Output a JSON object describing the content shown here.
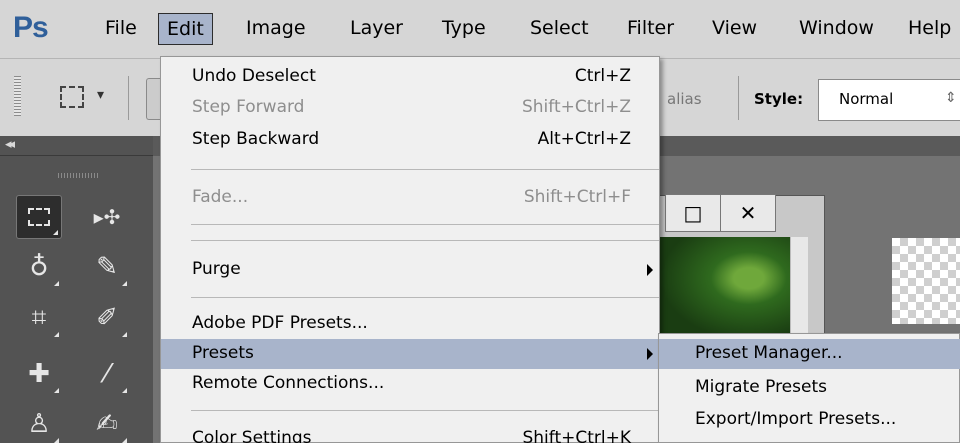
{
  "app": {
    "logo_text": "Ps",
    "brand_color": "#2f5f9a"
  },
  "menubar": {
    "items": [
      "File",
      "Edit",
      "Image",
      "Layer",
      "Type",
      "Select",
      "Filter",
      "View",
      "Window",
      "Help"
    ]
  },
  "options_bar": {
    "antialias_label": "alias",
    "style_label": "Style:",
    "style_value": "Normal"
  },
  "edit_menu": {
    "items": [
      {
        "label": "Undo Deselect",
        "shortcut": "Ctrl+Z",
        "enabled": true
      },
      {
        "label": "Step Forward",
        "shortcut": "Shift+Ctrl+Z",
        "enabled": false
      },
      {
        "label": "Step Backward",
        "shortcut": "Alt+Ctrl+Z",
        "enabled": true
      },
      {
        "label": "Fade...",
        "shortcut": "Shift+Ctrl+F",
        "enabled": false
      },
      {
        "label": "Purge",
        "shortcut": "",
        "enabled": true,
        "submenu": true
      },
      {
        "label": "Adobe PDF Presets...",
        "shortcut": "",
        "enabled": true
      },
      {
        "label": "Presets",
        "shortcut": "",
        "enabled": true,
        "submenu": true,
        "highlighted": true
      },
      {
        "label": "Remote Connections...",
        "shortcut": "",
        "enabled": true
      },
      {
        "label": "Color Settings",
        "shortcut": "Shift+Ctrl+K",
        "enabled": true
      }
    ]
  },
  "presets_submenu": {
    "items": [
      {
        "label": "Preset Manager...",
        "highlighted": true
      },
      {
        "label": "Migrate Presets"
      },
      {
        "label": "Export/Import Presets..."
      }
    ]
  },
  "document_window": {
    "minimize_glyph": "□",
    "close_glyph": "✕"
  },
  "tools": {
    "icons": [
      "rect-marquee",
      "move",
      "lasso",
      "quick-selection",
      "crop",
      "eyedropper",
      "spot-healing-brush",
      "brush",
      "clone-stamp",
      "history-brush"
    ]
  },
  "colors": {
    "menu_highlight": "#a8b4cb",
    "panel_bg": "#535353",
    "chrome_bg": "#d6d6d6"
  }
}
